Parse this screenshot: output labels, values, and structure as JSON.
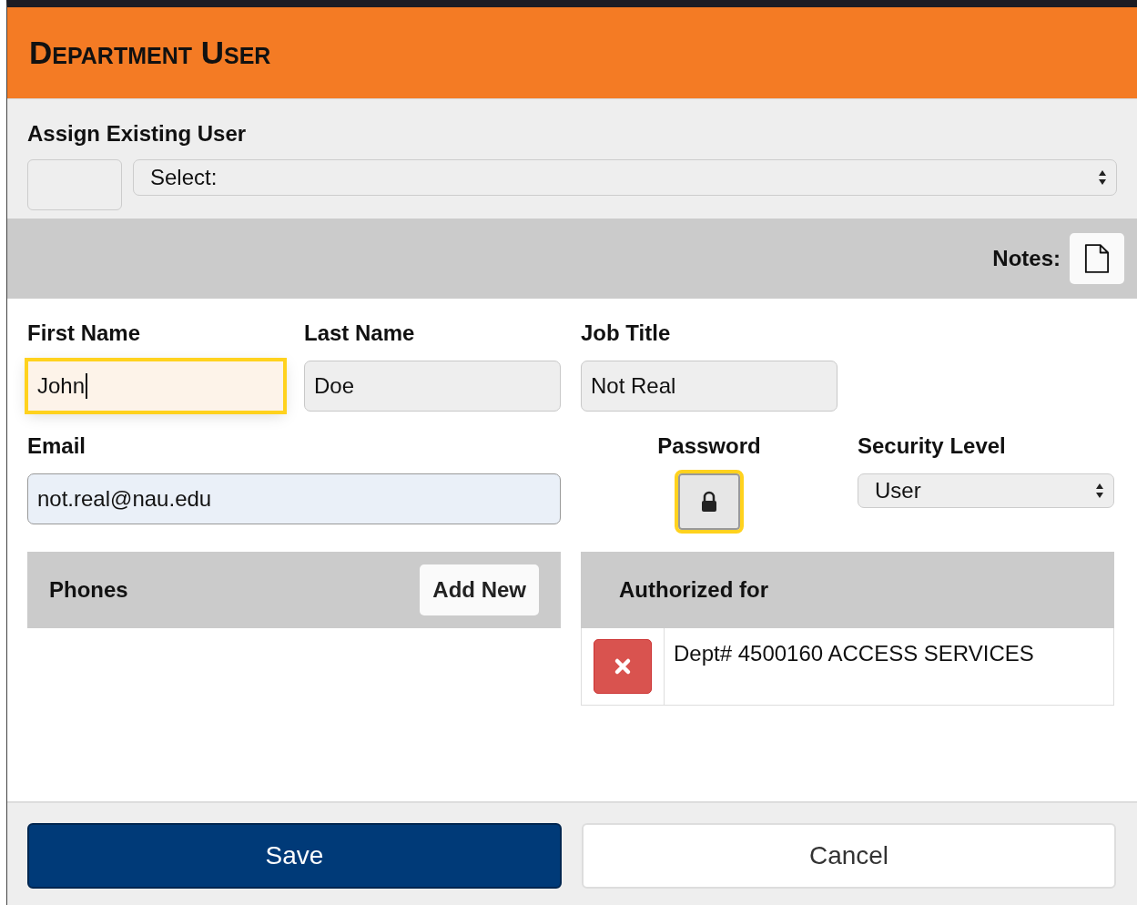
{
  "dialog": {
    "title": "Department User"
  },
  "assign": {
    "label": "Assign Existing User",
    "select": {
      "value": "Select:"
    }
  },
  "notes": {
    "label": "Notes:"
  },
  "fields": [
    {
      "label": "First Name",
      "value": "John",
      "focused": true
    },
    {
      "label": "Last Name",
      "value": "Doe",
      "focused": false
    },
    {
      "label": "Job Title",
      "value": "Not Real",
      "focused": false
    }
  ],
  "email": {
    "label": "Email",
    "value": "not.real@nau.edu",
    "focused": false
  },
  "password": {
    "label": "Password",
    "focused": true
  },
  "security": {
    "label": "Security Level",
    "value": "User"
  },
  "phones": {
    "title": "Phones",
    "add_button": "Add New"
  },
  "authorized": {
    "title": "Authorized for",
    "rows": [
      {
        "text": "Dept# 4500160 ACCESS SERVICES"
      }
    ]
  },
  "buttons": [
    {
      "label": "Save",
      "kind": "primary"
    },
    {
      "label": "Cancel",
      "kind": "secondary"
    }
  ]
}
